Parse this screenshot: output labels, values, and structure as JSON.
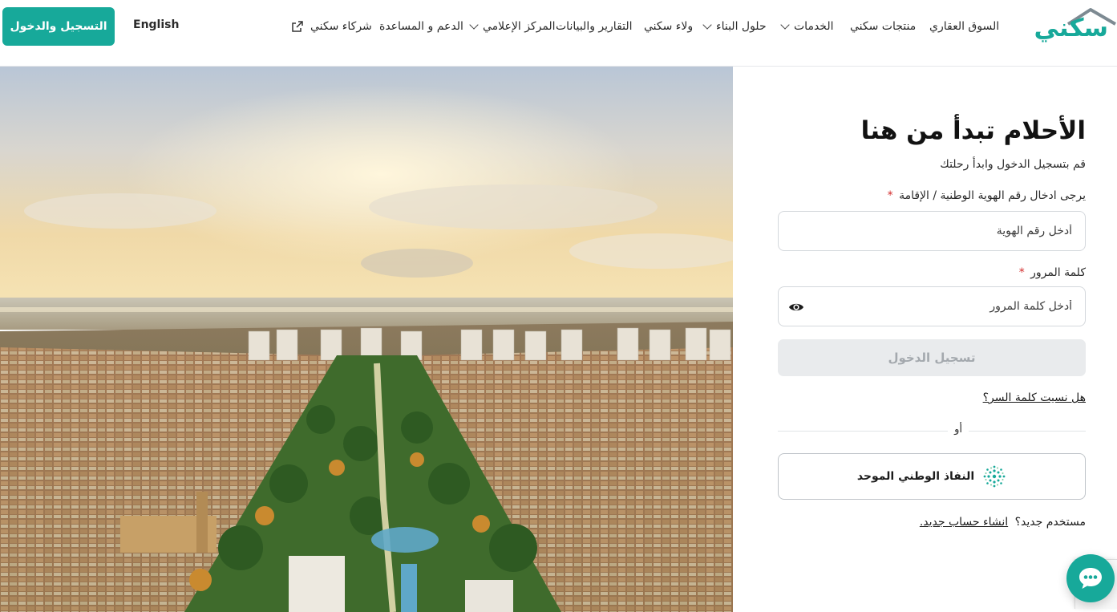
{
  "header": {
    "logo_text": "سكني",
    "nav": [
      {
        "label": "السوق العقاري",
        "has_dropdown": false
      },
      {
        "label": "منتجات سكني",
        "has_dropdown": false
      },
      {
        "label": "الخدمات",
        "has_dropdown": true
      },
      {
        "label": "حلول البناء",
        "has_dropdown": true
      },
      {
        "label": "ولاء سكني",
        "has_dropdown": false
      },
      {
        "label": "التقارير والبيانات",
        "has_dropdown": false
      },
      {
        "label": "المركز الإعلامي",
        "has_dropdown": true
      },
      {
        "label": "الدعم و المساعدة",
        "has_dropdown": false
      },
      {
        "label": "شركاء سكني",
        "has_dropdown": false,
        "external": true
      }
    ],
    "language_label": "English",
    "cta_label": "التسجيل والدخول"
  },
  "login": {
    "title": "الأحلام تبدأ من هنا",
    "subtitle": "قم بتسجيل الدخول وابدأ رحلتك",
    "id_label": "يرجى ادخال رقم الهوية الوطنية / الإقامة",
    "id_placeholder": "أدخل رقم الهوية",
    "password_label": "كلمة المرور",
    "password_placeholder": "أدخل كلمة المرور",
    "required_mark": "*",
    "submit_label": "تسجيل الدخول",
    "forgot_label": "هل نسيت كلمة السر؟",
    "or_label": "أو",
    "nafath_label": "النفاذ الوطني الموحد",
    "new_user_text": "مستخدم جديد؟",
    "create_account_label": "انشاء حساب جديد."
  },
  "icons": {
    "external": "external-link-icon",
    "eye": "eye-icon",
    "chat": "chat-icon",
    "nafath": "nafath-logo-icon"
  },
  "colors": {
    "brand": "#17a99a",
    "disabled_button": "#e9ebed",
    "required": "#d22b2b"
  }
}
